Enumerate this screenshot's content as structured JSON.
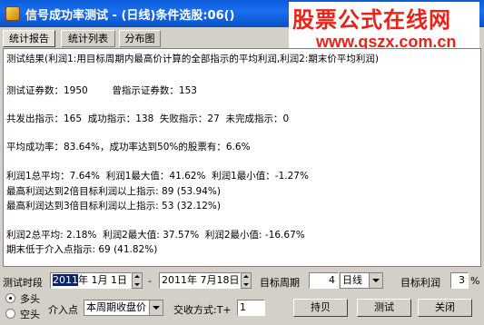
{
  "window": {
    "title": "信号成功率测试 - (日线)条件选股:06()"
  },
  "watermark": {
    "line1": "股票公式在线网",
    "line2": "www.gszx.com.cn"
  },
  "tabs": [
    {
      "label": "统计报告"
    },
    {
      "label": "统计列表"
    },
    {
      "label": "分布图"
    }
  ],
  "report": {
    "lines": [
      "测试结果(利润1:用目标周期内最高价计算的全部指示的平均利润,利润2:期末价平均利润)",
      "",
      "测试证券数：1950        曾指示证券数：153",
      "",
      "共发出指示：165  成功指示：138  失败指示：27  未完成指示：0",
      "",
      "平均成功率：83.64%，成功率达到50%的股票有：6.6%",
      "",
      "利润1总平均：7.64%  利润1最大值：41.62%  利润1最小值：-1.27%",
      "最高利润达到2倍目标利润以上指示: 89 (53.94%)",
      "最高利润达到3倍目标利润以上指示: 53 (32.12%)",
      "",
      "利润2总平均: 2.18%  利润2最大值: 37.57%  利润2最小值: -16.67%",
      "期末低于介入点指示: 69 (41.82%)"
    ]
  },
  "controls": {
    "period_label": "测试时段",
    "start_year": "2011",
    "start_rest": "年  1月  1日",
    "dash": "-",
    "end_date": "2011年  7月18日",
    "target_period_label": "目标周期",
    "target_period_value": "4",
    "period_unit": "日线",
    "target_profit_label": "目标利润",
    "target_profit_value": "3",
    "percent": "%",
    "long_label": "多头",
    "short_label": "空头",
    "entry_label": "介入点",
    "entry_value": "本周期收盘价",
    "trade_label": "交收方式:T+",
    "trade_value": "1",
    "buttons": {
      "hold": "持贝",
      "test": "测试",
      "close": "关闭"
    }
  }
}
